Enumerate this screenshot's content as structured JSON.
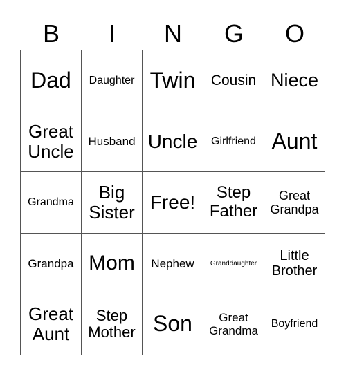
{
  "header": [
    "B",
    "I",
    "N",
    "G",
    "O"
  ],
  "cells": [
    "Dad",
    "Daughter",
    "Twin",
    "Cousin",
    "Niece",
    "Great Uncle",
    "Husband",
    "Uncle",
    "Girlfriend",
    "Aunt",
    "Grandma",
    "Big Sister",
    "Free!",
    "Step Father",
    "Great Grandpa",
    "Grandpa",
    "Mom",
    "Nephew",
    "Granddaughter",
    "Little Brother",
    "Great Aunt",
    "Step Mother",
    "Son",
    "Great Grandma",
    "Boyfriend"
  ]
}
